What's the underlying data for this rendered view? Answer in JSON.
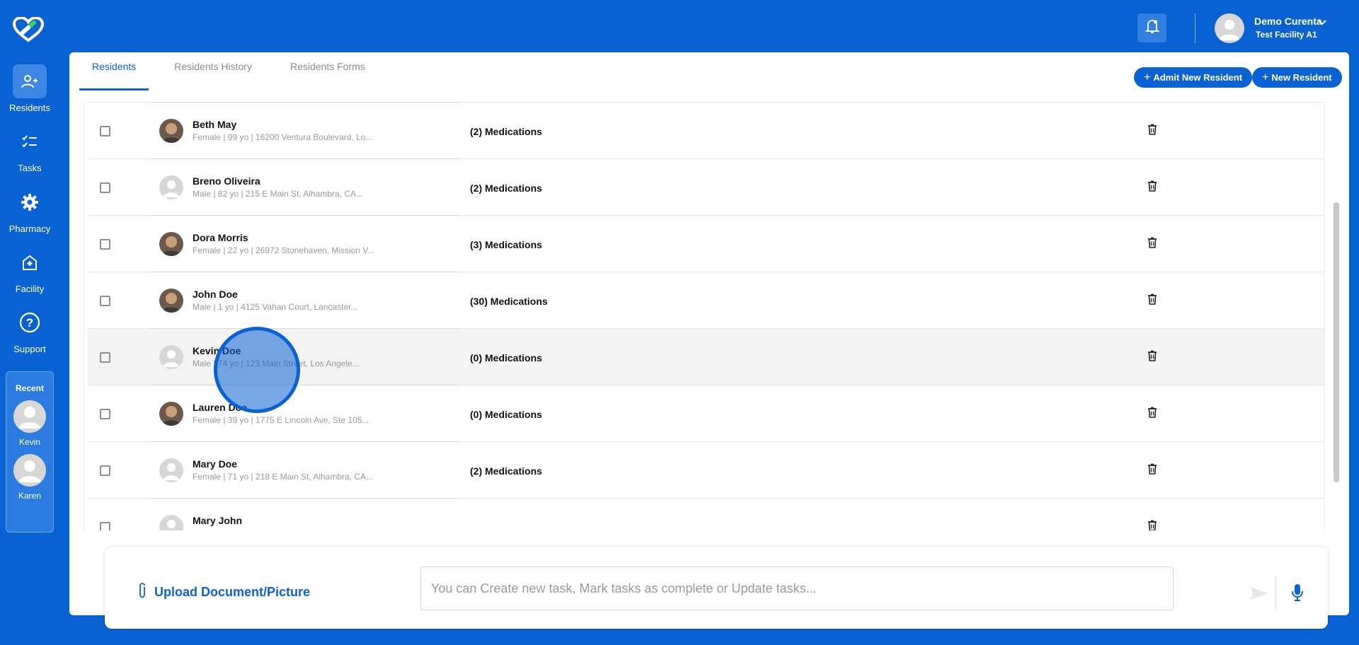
{
  "nav": {
    "items": [
      {
        "label": "Residents",
        "icon": "residents-icon"
      },
      {
        "label": "Tasks",
        "icon": "tasks-icon"
      },
      {
        "label": "Pharmacy",
        "icon": "gear-icon"
      },
      {
        "label": "Facility",
        "icon": "facility-icon"
      },
      {
        "label": "Support",
        "icon": "help-icon"
      }
    ],
    "recent": {
      "title": "Recent",
      "people": [
        {
          "name": "Kevin"
        },
        {
          "name": "Karen"
        }
      ]
    }
  },
  "header": {
    "user_name": "Demo Curenta",
    "facility": "Test Facility A1"
  },
  "tabs": [
    {
      "label": "Residents",
      "active": true
    },
    {
      "label": "Residents History",
      "active": false
    },
    {
      "label": "Residents Forms",
      "active": false
    }
  ],
  "actions": {
    "admit_label": "Admit New Resident",
    "new_label": "New Resident"
  },
  "residents": [
    {
      "name": "Beth May",
      "meta": "Female | 99 yo | 16200 Ventura Boulevard, Lo...",
      "meds": "(2) Medications",
      "avatar": "photo"
    },
    {
      "name": "Breno Oliveira",
      "meta": "Male | 82 yo | 215 E Main St, Alhambra, CA...",
      "meds": "(2) Medications",
      "avatar": "placeholder"
    },
    {
      "name": "Dora Morris",
      "meta": "Female | 22 yo | 26972 Stonehaven, Mission V...",
      "meds": "(3) Medications",
      "avatar": "photo"
    },
    {
      "name": "John Doe",
      "meta": "Male | 1 yo | 4125 Vahan Court, Lancaster...",
      "meds": "(30) Medications",
      "avatar": "photo"
    },
    {
      "name": "Kevin Doe",
      "meta": "Male | 74 yo | 123 Main Street, Los Angele...",
      "meds": "(0) Medications",
      "avatar": "placeholder"
    },
    {
      "name": "Lauren Doe",
      "meta": "Female | 39 yo | 1775 E Lincoln Ave, Ste 105...",
      "meds": "(0) Medications",
      "avatar": "photo"
    },
    {
      "name": "Mary Doe",
      "meta": "Female | 71 yo | 218 E Main St, Alhambra, CA...",
      "meds": "(2) Medications",
      "avatar": "placeholder"
    },
    {
      "name": "Mary John",
      "meta": "",
      "meds": "",
      "avatar": "placeholder"
    }
  ],
  "chat": {
    "upload_label": "Upload Document/Picture",
    "placeholder": "You can Create new task, Mark tasks as complete or Update tasks..."
  },
  "colors": {
    "brand": "#0a62d2",
    "background": "#ffffff"
  }
}
